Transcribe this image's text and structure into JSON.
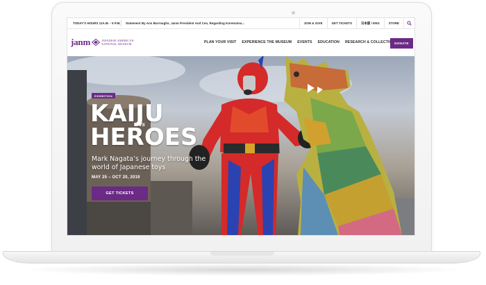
{
  "utility_bar": {
    "hours": "TODAY'S HOURS 11A.M. - 5 P.M.",
    "news": "Statement By Ann Burroughs, Janm President And Ceo, Regarding Korematsu...",
    "links": [
      "JOIN & GIVE",
      "GET TICKETS",
      "日本語 / ENG",
      "STORE"
    ],
    "search_icon": "search-icon"
  },
  "header": {
    "logo_word": "janm",
    "logo_line1": "JAPANESE AMERICAN",
    "logo_line2": "NATIONAL MUSEUM",
    "nav": [
      "PLAN YOUR VISIT",
      "EXPERIENCE THE MUSEUM",
      "EVENTS",
      "EDUCATION",
      "RESEARCH & COLLECTIONS"
    ],
    "donate_label": "DONATE"
  },
  "hero": {
    "badge": "EXHIBITION",
    "title_line1": "KAIJU",
    "title_vs": "vs",
    "title_line2": "HEROES",
    "subtitle": "Mark Nagata’s journey through the world of Japanese toys",
    "dates": "MAY 25 – OCT 20, 2019",
    "cta_label": "GET TICKETS"
  },
  "colors": {
    "brand_purple": "#6b2a85"
  }
}
